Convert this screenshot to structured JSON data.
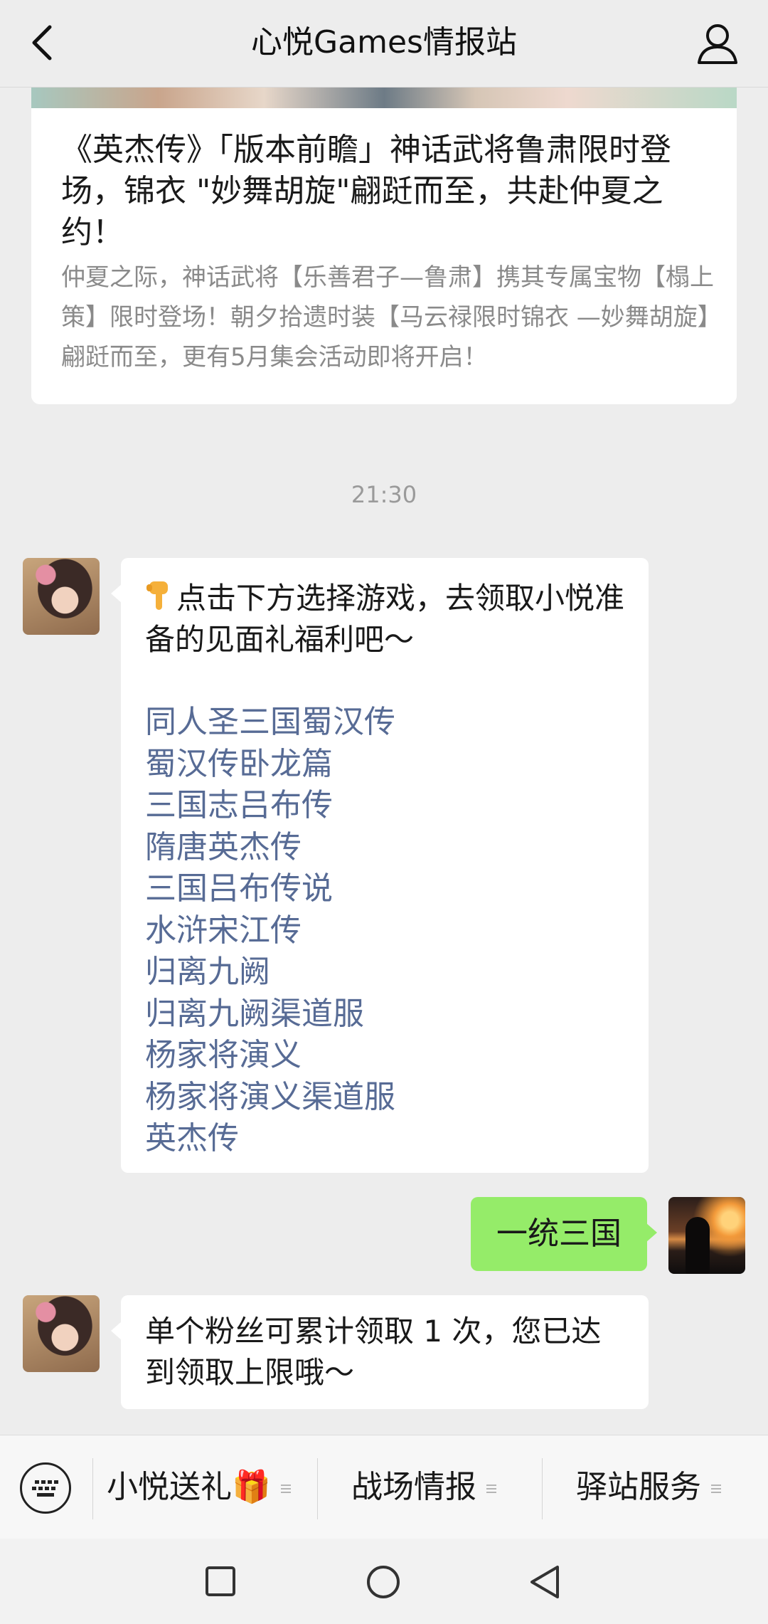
{
  "header": {
    "title": "心悦Games情报站"
  },
  "article": {
    "title": "《英杰传》「版本前瞻」神话武将鲁肃限时登场，锦衣 \"妙舞胡旋\"翩跹而至，共赴仲夏之约！",
    "description": "仲夏之际，神话武将【乐善君子—鲁肃】携其专属宝物【榻上策】限时登场！朝夕拾遗时装【马云禄限时锦衣 —妙舞胡旋】翩跹而至，更有5月集会活动即将开启！"
  },
  "timestamp": "21:30",
  "messages": {
    "bot_intro": "点击下方选择游戏，去领取小悦准备的见面礼福利吧～",
    "games": [
      "同人圣三国蜀汉传",
      "蜀汉传卧龙篇",
      "三国志吕布传",
      "隋唐英杰传",
      "三国吕布传说",
      "水浒宋江传",
      "归离九阙",
      "归离九阙渠道服",
      "杨家将演义",
      "杨家将演义渠道服",
      "英杰传"
    ],
    "user_reply": "一统三国",
    "bot_reply": "单个粉丝可累计领取 1 次，您已达到领取上限哦～"
  },
  "bottom_menu": {
    "items": [
      "小悦送礼🎁",
      "战场情报",
      "驿站服务"
    ]
  },
  "colors": {
    "background": "#ededed",
    "link": "#576b95",
    "user_bubble": "#95ec69"
  }
}
